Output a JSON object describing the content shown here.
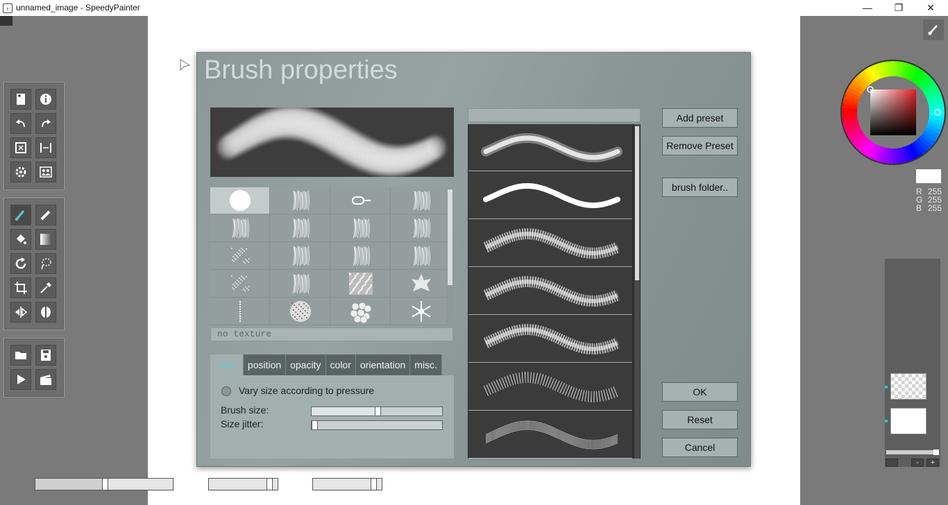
{
  "window": {
    "title": "unnamed_image - SpeedyPainter",
    "minimize_glyph": "—",
    "maximize_glyph": "❐",
    "close_glyph": "✕",
    "app_icon_glyph": "♁"
  },
  "tools": {
    "file_group": [
      "new-document-icon",
      "info-icon",
      "undo-icon",
      "redo-icon",
      "rotate-canvas-icon",
      "flip-icon",
      "settings-icon",
      "compare-icon"
    ],
    "paint_group": [
      "brush-icon",
      "eraser-icon",
      "fill-icon",
      "gradient-icon",
      "rotate-icon",
      "lasso-icon",
      "crop-icon",
      "eyedropper-icon",
      "symmetry-icon",
      "mask-icon"
    ],
    "media_group": [
      "open-folder-icon",
      "save-icon",
      "play-icon",
      "clapperboard-icon"
    ]
  },
  "bottom_sliders": {
    "zoom_fraction": 0.5,
    "slider2_fraction": 0.9,
    "slider3_fraction": 0.9
  },
  "dialog": {
    "title": "Brush properties",
    "no_texture_label": "no texture",
    "tabs": [
      "size",
      "position",
      "opacity",
      "color",
      "orientation",
      "misc."
    ],
    "active_tab": "size",
    "vary_size_label": "Vary size according to pressure",
    "vary_size_checked": false,
    "brush_size_label": "Brush size:",
    "brush_size_value_fraction": 0.5,
    "size_jitter_label": "Size jitter:",
    "size_jitter_value_fraction": 0.0,
    "textures": [
      "round",
      "hatching-vertical",
      "chain-link",
      "hatching-dense",
      "grass-strokes",
      "leaves",
      "feather",
      "fern",
      "dots-scatter",
      "plant-stem",
      "twig",
      "tree",
      "spray-dots",
      "pine",
      "noise-square",
      "maple-leaf",
      "dotted-line",
      "sphere-noise",
      "bubbles",
      "snowflake"
    ],
    "buttons": {
      "add_preset": "Add preset",
      "remove_preset": "Remove Preset",
      "brush_folder": "brush folder..",
      "ok": "OK",
      "reset": "Reset",
      "cancel": "Cancel"
    },
    "presets": [
      "soft-airbrush",
      "hard-ink",
      "chalk",
      "dry-brush",
      "bristle",
      "spray",
      "hair-lines"
    ]
  },
  "color_panel": {
    "r_label": "R",
    "g_label": "G",
    "b_label": "B",
    "r": "255",
    "g": "255",
    "b": "255",
    "current_color": "#ffffff"
  },
  "layers": {
    "minus_label": "-",
    "plus_label": "+"
  },
  "colors": {
    "accent": "#5ec8d8",
    "panel": "#7a7a7a",
    "dialog": "#929e9e"
  }
}
